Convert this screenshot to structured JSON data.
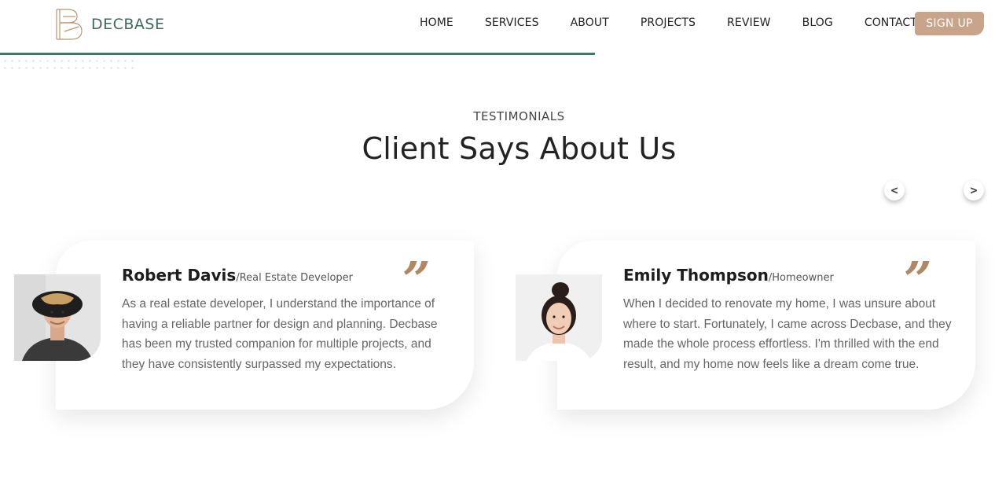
{
  "header": {
    "logo_letter": "B",
    "logo_text": "DECBASE",
    "nav": [
      "HOME",
      "SERVICES",
      "ABOUT",
      "PROJECTS",
      "REVIEW",
      "BLOG",
      "CONTACT"
    ],
    "signup_label": "SIGN UP"
  },
  "section": {
    "label": "TESTIMONIALS",
    "title": "Client Says About Us"
  },
  "carousel": {
    "prev_label": "<",
    "next_label": ">"
  },
  "testimonials": [
    {
      "name": "Robert Davis",
      "role": "/Real Estate Developer",
      "text": "As a real estate developer, I understand the importance of having a reliable partner for design and planning. Decbase has been my trusted companion for multiple projects, and they have consistently surpassed my expectations."
    },
    {
      "name": "Emily Thompson",
      "role": "/Homeowner",
      "text": "When I decided to renovate my home, I was unsure about where to start. Fortunately, I came across Decbase, and they made the whole process effortless. I'm thrilled with the end result, and my home now feels like a dream come true."
    }
  ],
  "quote_mark": "”",
  "colors": {
    "accent": "#c8a48a",
    "brand_green": "#3c7a64",
    "quote": "#b08864"
  }
}
